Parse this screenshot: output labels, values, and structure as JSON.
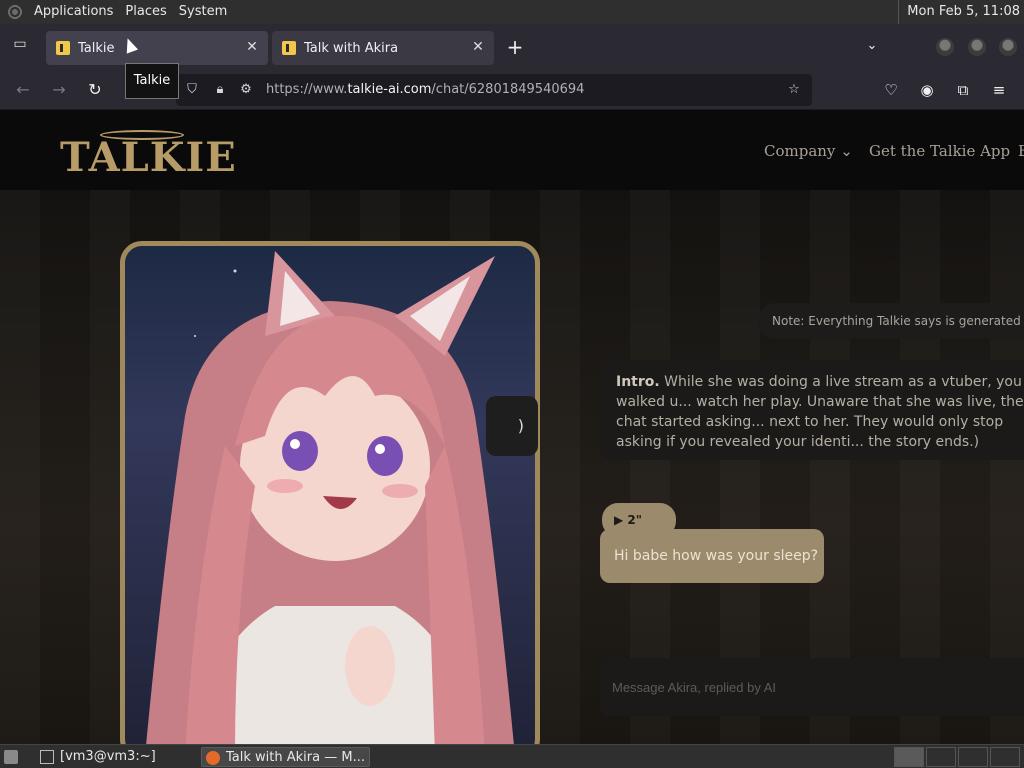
{
  "top_panel": {
    "menus": [
      "Applications",
      "Places",
      "System"
    ],
    "clock": "Mon Feb  5, 11:08"
  },
  "tabs": [
    {
      "title": "Talkie",
      "active": true
    },
    {
      "title": "Talk with Akira",
      "active": false
    }
  ],
  "tooltip": "Talkie",
  "url": {
    "prefix": "https://www.",
    "host": "talkie-ai.com",
    "path": "/chat/62801849540694"
  },
  "site": {
    "logo": "TALKIE",
    "nav": [
      "Company",
      "Get the Talkie App",
      "E"
    ]
  },
  "chat": {
    "note": "Note: Everything Talkie says is generated by AI",
    "intro_label": "Intro.",
    "intro_text": "While she was doing a live stream as a vtuber, you walked u... watch her play. Unaware that she was live, the chat started asking... next to her. They would only stop asking if you revealed your identi... the story ends.)",
    "audio_duration": "2\"",
    "message": "Hi babe how was your sleep?",
    "input_placeholder": "Message Akira, replied by AI"
  },
  "taskbar": {
    "items": [
      "[vm3@vm3:~]",
      "Talk with Akira — M..."
    ]
  },
  "colors": {
    "accent_gold": "#a08a5c",
    "bubble": "#9c8a6c",
    "chrome_bg": "#2b2a33"
  }
}
